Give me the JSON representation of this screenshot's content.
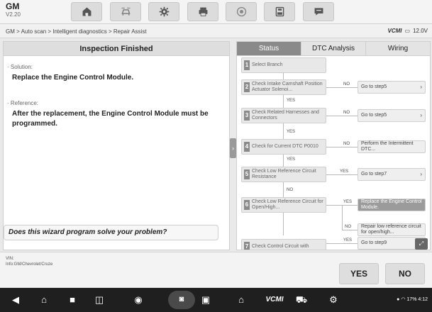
{
  "app": {
    "name": "GM",
    "version": "V2.20"
  },
  "toolbar": {
    "icons": [
      "home-icon",
      "vehicle-swap-icon",
      "gear-icon",
      "printer-icon",
      "help-icon",
      "save-icon",
      "chat-icon"
    ]
  },
  "breadcrumb": "GM > Auto scan > Intelligent diagnostics > Repair Assist",
  "vcm": {
    "label": "VCMI",
    "voltage": "12.0V"
  },
  "left": {
    "title": "Inspection Finished",
    "solution_label": "· Solution:",
    "solution_text": "Replace the Engine Control Module.",
    "reference_label": "· Reference:",
    "reference_text": "After the replacement, the Engine Control Module must be programmed.",
    "question": "Does this wizard program solve your problem?"
  },
  "tabs": [
    {
      "label": "Status",
      "active": true
    },
    {
      "label": "DTC Analysis",
      "active": false
    },
    {
      "label": "Wiring",
      "active": false
    }
  ],
  "flow": {
    "steps": [
      {
        "num": "1",
        "text": "Select Branch"
      },
      {
        "num": "2",
        "text": "Check Intake Camshaft Position Actuator Solenoi..."
      },
      {
        "num": "3",
        "text": "Check Related Harnesses and Connectors"
      },
      {
        "num": "4",
        "text": "Check for Current DTC P0010"
      },
      {
        "num": "5",
        "text": "Check Low Reference Circuit Resistance"
      },
      {
        "num": "6",
        "text": "Check Low Reference Circuit for Open/High..."
      },
      {
        "num": "7",
        "text": "Check Control Circuit with"
      }
    ],
    "results": [
      {
        "text": "Go to step5",
        "branch": "NO"
      },
      {
        "text": "Go to step5",
        "branch": "NO"
      },
      {
        "text": "Perform the Intermittent DTC...",
        "branch": "NO"
      },
      {
        "text": "Go to step7",
        "branch": "YES"
      },
      {
        "text": "Replace the Engine Control Module.",
        "branch": "YES"
      },
      {
        "text": "Repair low reference circuit for open/high...",
        "branch": "NO"
      },
      {
        "text": "Go to step9",
        "branch": "YES"
      }
    ],
    "down_labels": [
      "YES",
      "YES",
      "YES",
      "NO"
    ]
  },
  "vehicle": {
    "vin_label": "VIN:",
    "info": "Info:GM/Chevrolet/Cruze"
  },
  "actions": {
    "yes": "YES",
    "no": "NO"
  },
  "android": {
    "status": "17% 4:12",
    "icons": [
      "back-icon",
      "home-icon",
      "square-icon",
      "overview-icon",
      "browser-icon",
      "camera-icon",
      "screen-record-icon",
      "car-home-icon",
      "vci-icon",
      "car-icon",
      "settings-icon"
    ]
  }
}
